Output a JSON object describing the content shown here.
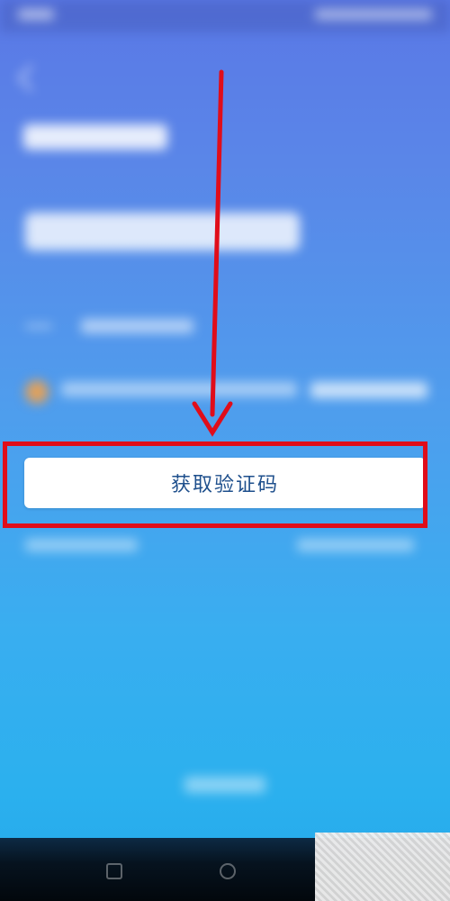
{
  "login": {
    "button_label": "获取验证码"
  },
  "annotation": {
    "color": "#e00d1a"
  },
  "colors": {
    "background_top": "#5a78e6",
    "background_bottom": "#24a8ea",
    "button_text": "#1e4f8c"
  },
  "icons": {
    "back": "back-chevron-icon",
    "agree": "checkbox-icon",
    "annotation": "red-arrow-icon"
  }
}
